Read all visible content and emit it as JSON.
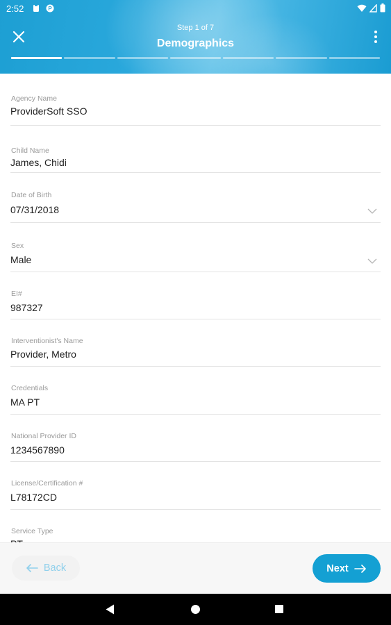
{
  "status_bar": {
    "time": "2:52"
  },
  "header": {
    "step_label": "Step 1 of 7",
    "title": "Demographics",
    "total_steps": 7,
    "current_step": 1
  },
  "fields": [
    {
      "label": "Agency Name",
      "value": "ProviderSoft SSO",
      "dropdown": false
    },
    {
      "label": "Child Name",
      "value": "James, Chidi",
      "dropdown": false
    },
    {
      "label": "Date of Birth",
      "value": "07/31/2018",
      "dropdown": true
    },
    {
      "label": "Sex",
      "value": "Male",
      "dropdown": true
    },
    {
      "label": "EI#",
      "value": "987327",
      "dropdown": false
    },
    {
      "label": "Interventionist's Name",
      "value": "Provider, Metro",
      "dropdown": false
    },
    {
      "label": "Credentials",
      "value": "MA PT",
      "dropdown": false
    },
    {
      "label": "National Provider ID",
      "value": "1234567890",
      "dropdown": false
    },
    {
      "label": "License/Certification #",
      "value": "L78172CD",
      "dropdown": false
    },
    {
      "label": "Service Type",
      "value": "PT",
      "dropdown": false
    }
  ],
  "footer": {
    "back_label": "Back",
    "next_label": "Next"
  },
  "colors": {
    "accent": "#14a0d3",
    "header": "#1d9fd3"
  },
  "icons": {
    "close": "close-icon",
    "menu": "more-vertical-icon",
    "chevron": "chevron-down-icon",
    "back_arrow": "arrow-left-icon",
    "next_arrow": "arrow-right-icon"
  }
}
